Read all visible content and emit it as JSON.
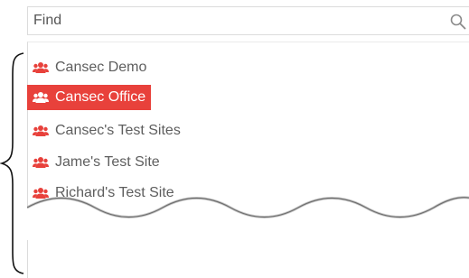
{
  "search": {
    "placeholder": "Find",
    "value": "",
    "icon": "search-icon"
  },
  "sites": {
    "items": [
      {
        "label": "Cansec Demo",
        "icon": "group-icon",
        "selected": false
      },
      {
        "label": "Cansec Office",
        "icon": "group-icon",
        "selected": true
      },
      {
        "label": "Cansec's Test Sites",
        "icon": "group-icon",
        "selected": false
      },
      {
        "label": "Jame's Test Site",
        "icon": "group-icon",
        "selected": false
      },
      {
        "label": "Richard's Test Site",
        "icon": "group-icon",
        "selected": false
      }
    ]
  },
  "colors": {
    "accent": "#e8413b",
    "item_text": "#5e5e5e",
    "selected_text": "#ffffff",
    "border": "#dcdcdc"
  }
}
